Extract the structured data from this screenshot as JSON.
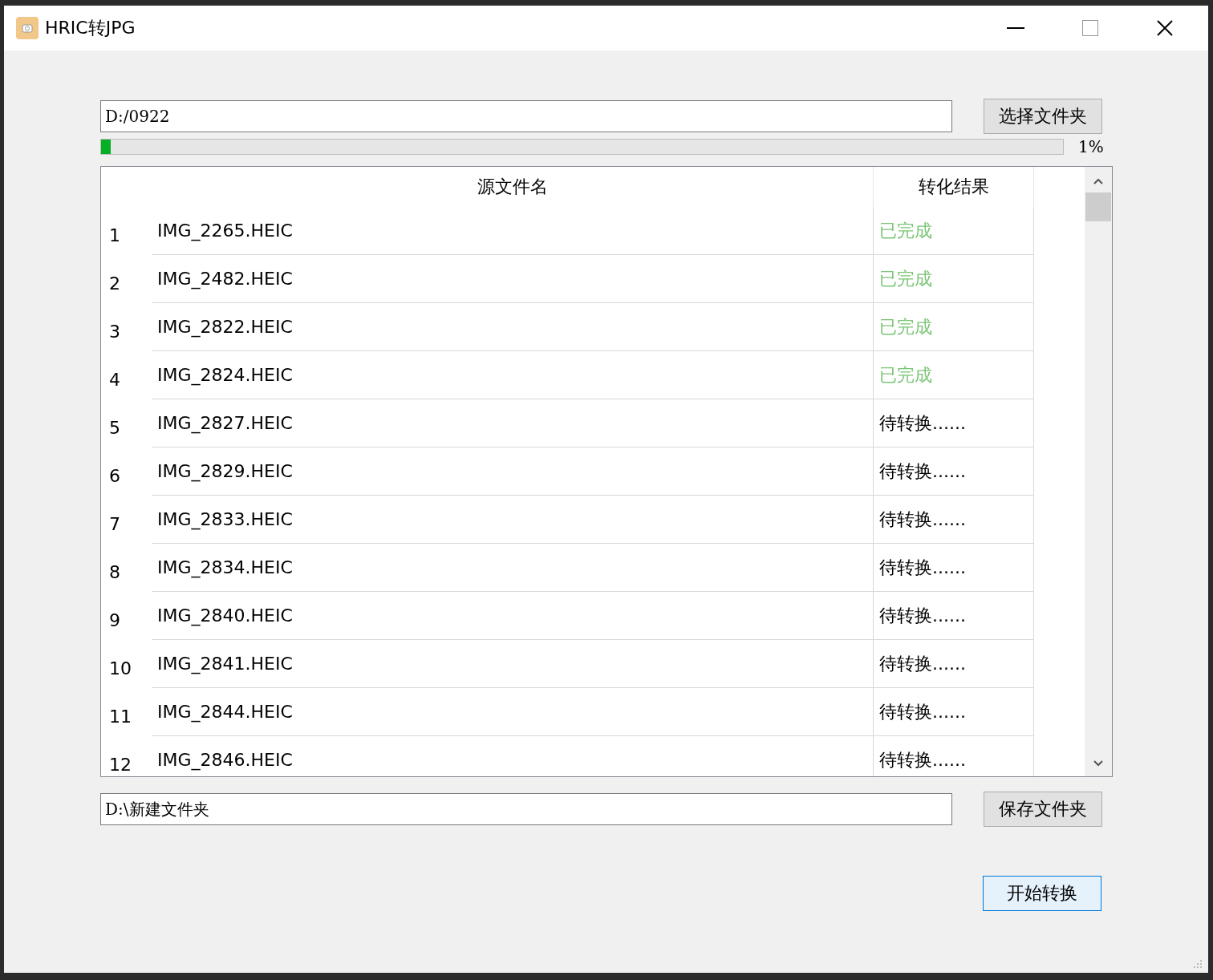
{
  "window": {
    "title": "HRIC转JPG"
  },
  "source": {
    "value": "D:/0922",
    "button": "选择文件夹"
  },
  "progress": {
    "level": 0.01,
    "reading": "1%"
  },
  "table": {
    "columns": [
      "源文件名",
      "转化结果"
    ],
    "rows": [
      {
        "index": "1",
        "file": "IMG_2265.HEIC",
        "result": "已完成",
        "kind": "done"
      },
      {
        "index": "2",
        "file": "IMG_2482.HEIC",
        "result": "已完成",
        "kind": "done"
      },
      {
        "index": "3",
        "file": "IMG_2822.HEIC",
        "result": "已完成",
        "kind": "done"
      },
      {
        "index": "4",
        "file": "IMG_2824.HEIC",
        "result": "已完成",
        "kind": "done"
      },
      {
        "index": "5",
        "file": "IMG_2827.HEIC",
        "result": "待转换......",
        "kind": "pending"
      },
      {
        "index": "6",
        "file": "IMG_2829.HEIC",
        "result": "待转换......",
        "kind": "pending"
      },
      {
        "index": "7",
        "file": "IMG_2833.HEIC",
        "result": "待转换......",
        "kind": "pending"
      },
      {
        "index": "8",
        "file": "IMG_2834.HEIC",
        "result": "待转换......",
        "kind": "pending"
      },
      {
        "index": "9",
        "file": "IMG_2840.HEIC",
        "result": "待转换......",
        "kind": "pending"
      },
      {
        "index": "10",
        "file": "IMG_2841.HEIC",
        "result": "待转换......",
        "kind": "pending"
      },
      {
        "index": "11",
        "file": "IMG_2844.HEIC",
        "result": "待转换......",
        "kind": "pending"
      },
      {
        "index": "12",
        "file": "IMG_2846.HEIC",
        "result": "待转换......",
        "kind": "pending"
      }
    ]
  },
  "target": {
    "value": "D:\\新建文件夹",
    "button": "保存文件夹"
  },
  "start_button": "开始转换"
}
